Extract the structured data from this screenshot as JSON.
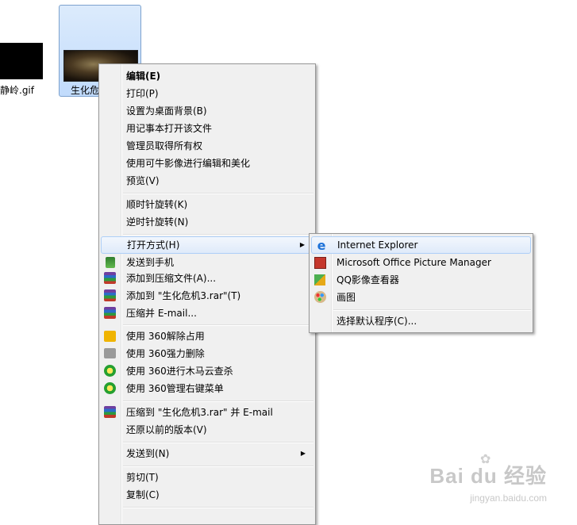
{
  "desktop": {
    "left_file_label": "静岭.gif",
    "selected_file_label": "生化危机3.rar"
  },
  "context_menu": {
    "items": [
      {
        "label": "编辑(E)"
      },
      {
        "label": "打印(P)"
      },
      {
        "label": "设置为桌面背景(B)"
      },
      {
        "label": "用记事本打开该文件"
      },
      {
        "label": "管理员取得所有权"
      },
      {
        "label": "使用可牛影像进行编辑和美化"
      },
      {
        "label": "预览(V)"
      },
      {
        "label": "顺时针旋转(K)"
      },
      {
        "label": "逆时针旋转(N)"
      },
      {
        "label": "打开方式(H)"
      },
      {
        "label": "发送到手机"
      },
      {
        "label": "添加到压缩文件(A)..."
      },
      {
        "label": "添加到 \"生化危机3.rar\"(T)"
      },
      {
        "label": "压缩并 E-mail..."
      },
      {
        "label": "使用 360解除占用"
      },
      {
        "label": "使用 360强力删除"
      },
      {
        "label": "使用 360进行木马云查杀"
      },
      {
        "label": "使用 360管理右键菜单"
      },
      {
        "label": "压缩到 \"生化危机3.rar\" 并 E-mail"
      },
      {
        "label": "还原以前的版本(V)"
      },
      {
        "label": "发送到(N)"
      },
      {
        "label": "剪切(T)"
      },
      {
        "label": "复制(C)"
      }
    ]
  },
  "submenu": {
    "items": [
      {
        "label": "Internet Explorer"
      },
      {
        "label": "Microsoft Office Picture Manager"
      },
      {
        "label": "QQ影像查看器"
      },
      {
        "label": "画图"
      },
      {
        "label": "选择默认程序(C)..."
      }
    ]
  },
  "watermark": {
    "main": "Bai du 经验",
    "sub": "jingyan.baidu.com"
  },
  "icons": {
    "send_to_phone": "phone-icon",
    "winrar": "winrar-icon",
    "unlock_360": "360-unlock-icon",
    "shred_360": "360-shred-icon",
    "trojan_360": "360-scan-icon",
    "menu_manage_360": "360-menu-icon",
    "ie": "internet-explorer-icon",
    "picture_manager": "picture-manager-icon",
    "qq_viewer": "qq-viewer-icon",
    "paint": "paint-icon"
  },
  "colors": {
    "highlight_border": "#aecff7",
    "menu_background": "#f0f0f0"
  }
}
